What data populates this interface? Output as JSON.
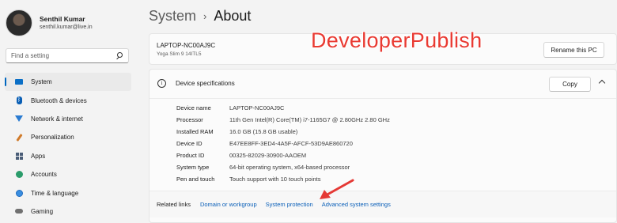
{
  "profile": {
    "name": "Senthil Kumar",
    "email": "senthil.kumar@live.in"
  },
  "search": {
    "placeholder": "Find a setting"
  },
  "nav": {
    "items": [
      {
        "label": "System",
        "icon": "system-icon"
      },
      {
        "label": "Bluetooth & devices",
        "icon": "bluetooth-icon"
      },
      {
        "label": "Network & internet",
        "icon": "wifi-icon"
      },
      {
        "label": "Personalization",
        "icon": "brush-icon"
      },
      {
        "label": "Apps",
        "icon": "apps-icon"
      },
      {
        "label": "Accounts",
        "icon": "person-icon"
      },
      {
        "label": "Time & language",
        "icon": "globe-clock-icon"
      },
      {
        "label": "Gaming",
        "icon": "controller-icon"
      }
    ],
    "active": "System"
  },
  "breadcrumb": {
    "parent": "System",
    "separator": "›",
    "current": "About"
  },
  "device": {
    "name": "LAPTOP-NC00AJ9C",
    "model": "Yoga Slim 9 14ITL5",
    "rename_label": "Rename this PC"
  },
  "watermark": "DeveloperPublish",
  "specs": {
    "title": "Device specifications",
    "copy_label": "Copy",
    "rows": [
      {
        "label": "Device name",
        "value": "LAPTOP-NC00AJ9C"
      },
      {
        "label": "Processor",
        "value": "11th Gen Intel(R) Core(TM) i7-1165G7 @ 2.80GHz   2.80 GHz"
      },
      {
        "label": "Installed RAM",
        "value": "16.0 GB (15.8 GB usable)"
      },
      {
        "label": "Device ID",
        "value": "E47EE8FF-3ED4-4A5F-AFCF-53D9AE860720"
      },
      {
        "label": "Product ID",
        "value": "00325-82029-30900-AAOEM"
      },
      {
        "label": "System type",
        "value": "64-bit operating system, x64-based processor"
      },
      {
        "label": "Pen and touch",
        "value": "Touch support with 10 touch points"
      }
    ]
  },
  "related": {
    "label": "Related links",
    "links": [
      "Domain or workgroup",
      "System protection",
      "Advanced system settings"
    ]
  },
  "colors": {
    "accent": "#0067c0",
    "link": "#0a5fb8",
    "watermark": "#e93a32",
    "arrow": "#e53935"
  }
}
